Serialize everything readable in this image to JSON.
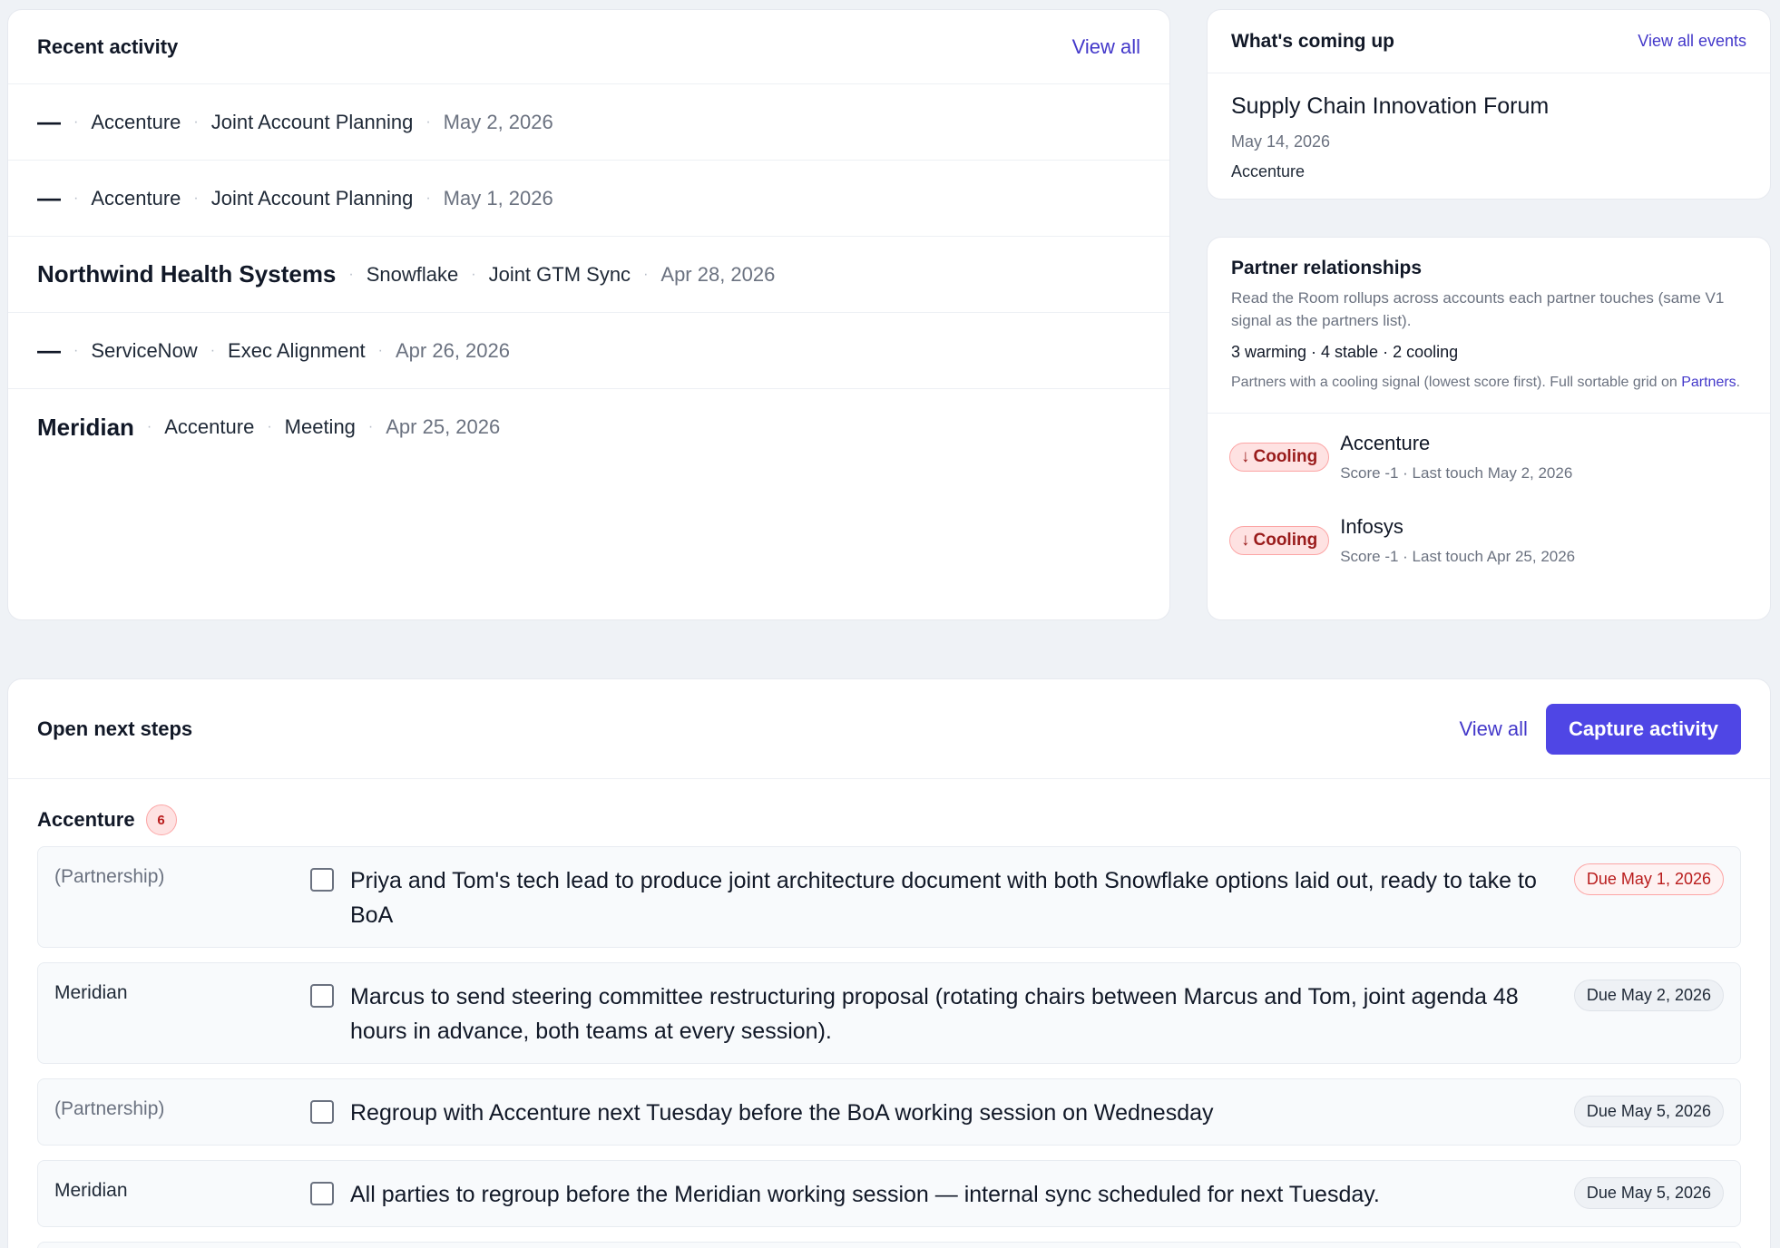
{
  "recent": {
    "title": "Recent activity",
    "view_all": "View all",
    "rows": [
      {
        "primary": "—",
        "partner": "Accenture",
        "type": "Joint Account Planning",
        "date": "May 2, 2026"
      },
      {
        "primary": "—",
        "partner": "Accenture",
        "type": "Joint Account Planning",
        "date": "May 1, 2026"
      },
      {
        "primary": "Northwind Health Systems",
        "partner": "Snowflake",
        "type": "Joint GTM Sync",
        "date": "Apr 28, 2026"
      },
      {
        "primary": "—",
        "partner": "ServiceNow",
        "type": "Exec Alignment",
        "date": "Apr 26, 2026"
      },
      {
        "primary": "Meridian",
        "partner": "Accenture",
        "type": "Meeting",
        "date": "Apr 25, 2026"
      }
    ],
    "separator": "·"
  },
  "upcoming": {
    "title": "What's coming up",
    "view_all": "View all events",
    "event": {
      "name": "Supply Chain Innovation Forum",
      "date": "May 14, 2026",
      "partner": "Accenture"
    }
  },
  "partners": {
    "title": "Partner relationships",
    "description": "Read the Room rollups across accounts each partner touches (same V1 signal as the partners list).",
    "counts": "3 warming · 4 stable · 2 cooling",
    "note_prefix": "Partners with a cooling signal (lowest score first). Full sortable grid on ",
    "note_link": "Partners",
    "note_suffix": ".",
    "items": [
      {
        "badge": "Cooling",
        "arrow": "↓",
        "name": "Accenture",
        "meta": "Score -1 · Last touch May 2, 2026"
      },
      {
        "badge": "Cooling",
        "arrow": "↓",
        "name": "Infosys",
        "meta": "Score -1 · Last touch Apr 25, 2026"
      }
    ]
  },
  "steps": {
    "title": "Open next steps",
    "view_all": "View all",
    "capture": "Capture activity",
    "group": {
      "name": "Accenture",
      "count": "6"
    },
    "tasks": [
      {
        "account": "(Partnership)",
        "text": "Priya and Tom's tech lead to produce joint architecture document with both Snowflake options laid out, ready to take to BoA",
        "due": "Due May 1, 2026",
        "overdue": true
      },
      {
        "account": "Meridian",
        "text": "Marcus to send steering committee restructuring proposal (rotating chairs between Marcus and Tom, joint agenda 48 hours in advance, both teams at every session).",
        "due": "Due May 2, 2026",
        "overdue": false
      },
      {
        "account": "(Partnership)",
        "text": "Regroup with Accenture next Tuesday before the BoA working session on Wednesday",
        "due": "Due May 5, 2026",
        "overdue": false
      },
      {
        "account": "Meridian",
        "text": "All parties to regroup before the Meridian working session — internal sync scheduled for next Tuesday.",
        "due": "Due May 5, 2026",
        "overdue": false
      }
    ]
  },
  "colors": {
    "accent": "#4f46e5",
    "link": "#4338ca",
    "cooling_bg": "#fee2e2",
    "cooling_text": "#991b1b",
    "page_bg": "#eff2f6"
  }
}
